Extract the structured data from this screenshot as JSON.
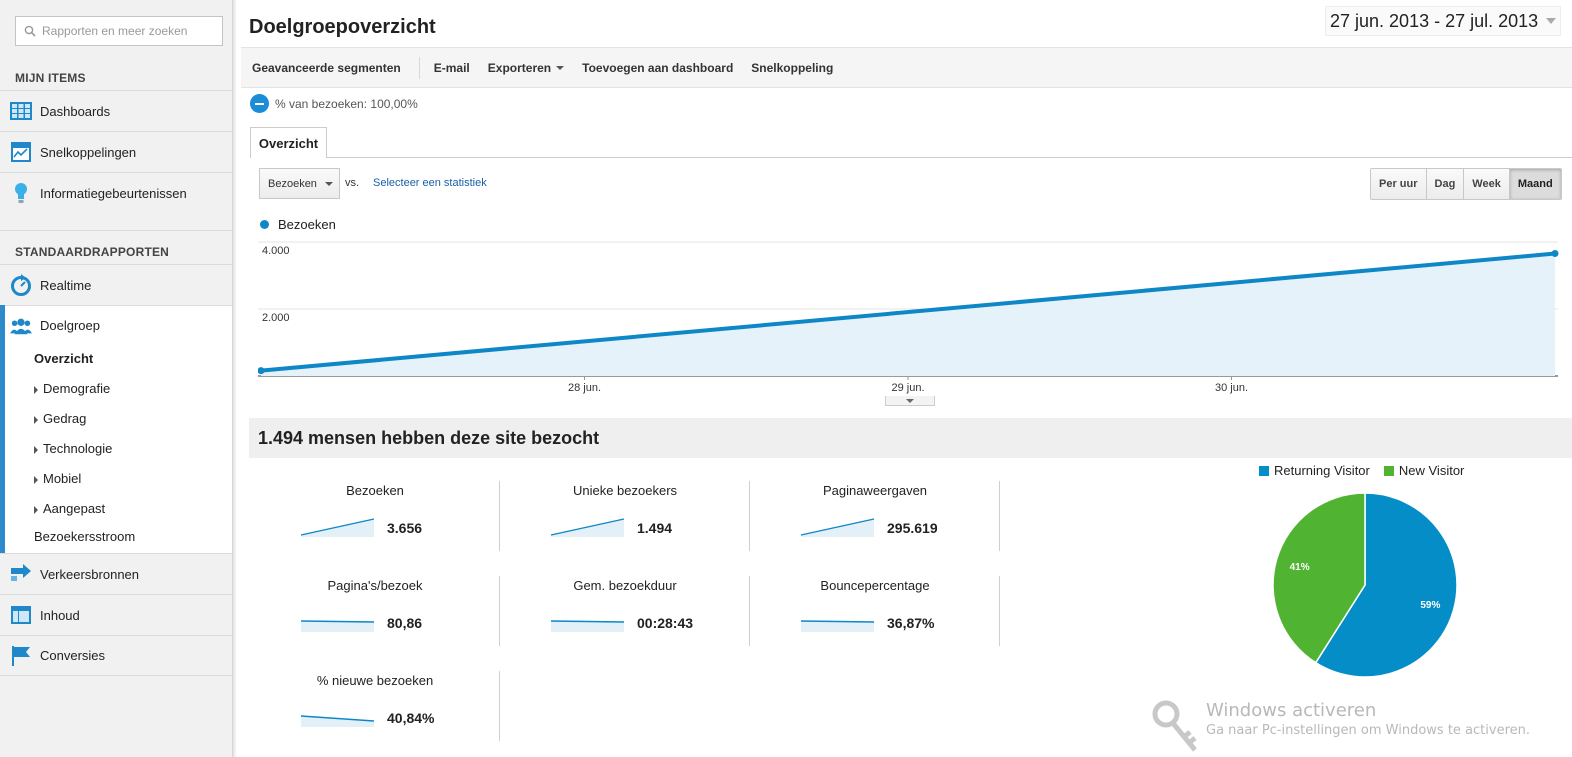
{
  "search": {
    "placeholder": "Rapporten en meer zoeken"
  },
  "sidebar": {
    "my_items_title": "MIJN ITEMS",
    "my_items": [
      {
        "label": "Dashboards",
        "icon": "dashboards-icon"
      },
      {
        "label": "Snelkoppelingen",
        "icon": "shortcuts-icon"
      },
      {
        "label": "Informatiegebeurtenissen",
        "icon": "lightbulb-icon"
      }
    ],
    "standard_title": "STANDAARDRAPPORTEN",
    "realtime": "Realtime",
    "audience": "Doelgroep",
    "audience_sub": {
      "overview": "Overzicht",
      "demographics": "Demografie",
      "behavior": "Gedrag",
      "technology": "Technologie",
      "mobile": "Mobiel",
      "custom": "Aangepast",
      "visitor_flow": "Bezoekersstroom"
    },
    "traffic": "Verkeersbronnen",
    "content": "Inhoud",
    "conversions": "Conversies"
  },
  "header": {
    "title": "Doelgroepoverzicht",
    "date_range": "27 jun. 2013 - 27 jul. 2013"
  },
  "toolbar": {
    "segments": "Geavanceerde segmenten",
    "email": "E-mail",
    "export": "Exporteren",
    "add_dashboard": "Toevoegen aan dashboard",
    "shortcut": "Snelkoppeling"
  },
  "segment": {
    "label": "% van bezoeken: 100,00%"
  },
  "tab": {
    "label": "Overzicht"
  },
  "controls": {
    "metric": "Bezoeken",
    "vs": "vs.",
    "select_stat": "Selecteer een statistiek",
    "periods": [
      "Per uur",
      "Dag",
      "Week",
      "Maand"
    ],
    "active_period": "Maand"
  },
  "colors": {
    "accent": "#0e87c7",
    "returning": "#058dc7",
    "new": "#50b432"
  },
  "chart_data": [
    {
      "type": "line",
      "series": [
        {
          "name": "Bezoeken",
          "values": [
            160,
            3656
          ]
        }
      ],
      "x": [
        0,
        1
      ],
      "x_tick_labels": [
        "28 jun.",
        "29 jun.",
        "30 jun."
      ],
      "y_tick_labels": [
        "4.000",
        "2.000"
      ],
      "ylim": [
        0,
        4000
      ],
      "grid": true
    },
    {
      "type": "pie",
      "categories": [
        "Returning Visitor",
        "New Visitor"
      ],
      "values": [
        59,
        41
      ],
      "labels": [
        "59%",
        "41%"
      ],
      "legend": "top"
    }
  ],
  "summary": {
    "title": "1.494 mensen hebben deze site bezocht"
  },
  "metrics": [
    {
      "label": "Bezoeken",
      "value": "3.656",
      "trend": "up"
    },
    {
      "label": "Unieke bezoekers",
      "value": "1.494",
      "trend": "up"
    },
    {
      "label": "Paginaweergaven",
      "value": "295.619",
      "trend": "up"
    },
    {
      "label": "Pagina's/bezoek",
      "value": "80,86",
      "trend": "flat"
    },
    {
      "label": "Gem. bezoekduur",
      "value": "00:28:43",
      "trend": "flat"
    },
    {
      "label": "Bouncepercentage",
      "value": "36,87%",
      "trend": "flat"
    },
    {
      "label": "% nieuwe bezoeken",
      "value": "40,84%",
      "trend": "down"
    }
  ],
  "watermark": {
    "title": "Windows activeren",
    "subtitle": "Ga naar Pc-instellingen om Windows te activeren."
  }
}
